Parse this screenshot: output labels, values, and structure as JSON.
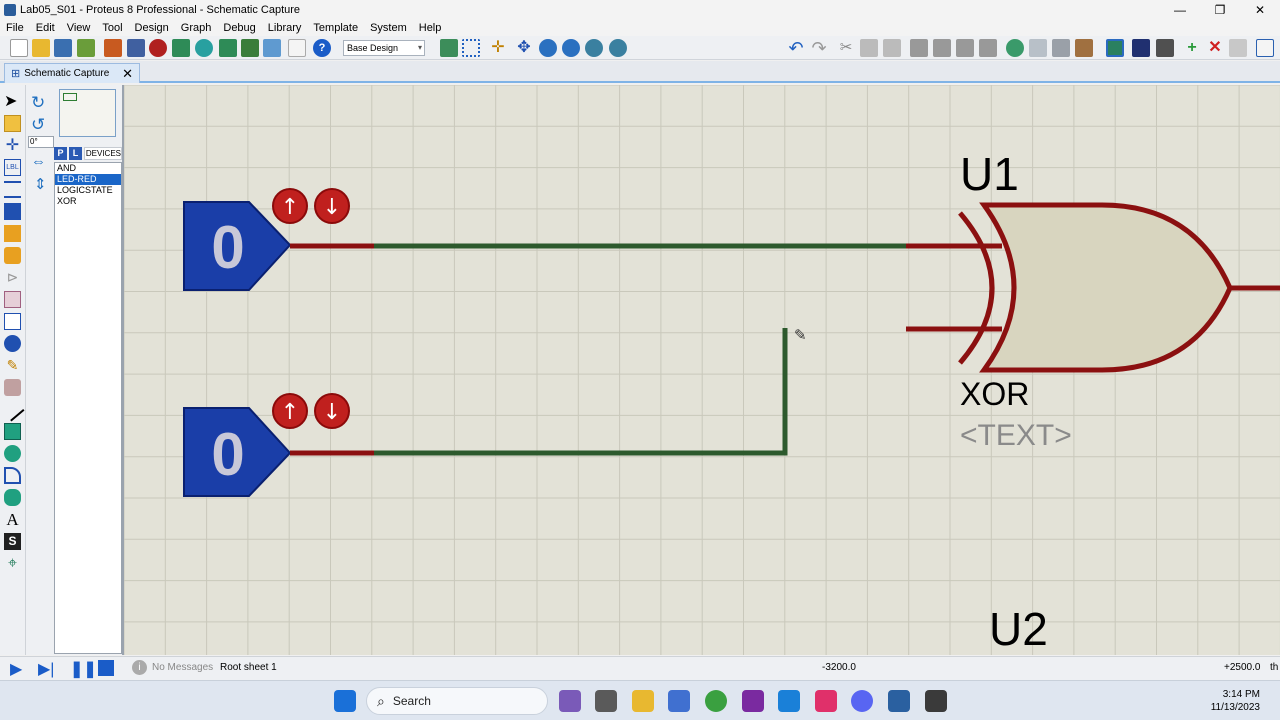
{
  "window": {
    "title": "Lab05_S01 - Proteus 8 Professional - Schematic Capture",
    "controls": {
      "minimize": "—",
      "maximize": "❐",
      "close": "✕"
    }
  },
  "menu": [
    "File",
    "Edit",
    "View",
    "Tool",
    "Design",
    "Graph",
    "Debug",
    "Library",
    "Template",
    "System",
    "Help"
  ],
  "toolbar": {
    "design_select": "Base Design",
    "icons": [
      "new-icon",
      "open-icon",
      "save-icon",
      "import-icon",
      "home-icon",
      "component-icon",
      "chip-icon",
      "back-icon",
      "zoom-area-icon",
      "layers-icon",
      "money-icon",
      "netlist-icon",
      "document-icon",
      "help-icon",
      "refresh-icon",
      "grid-icon",
      "origin-icon",
      "pan-icon",
      "zoom-in-icon",
      "zoom-out-icon",
      "zoom-all-icon",
      "zoom-fit-icon",
      "undo-icon",
      "redo-icon",
      "cut-icon",
      "copy-icon",
      "paste-icon",
      "block-copy-icon",
      "block-move-icon",
      "block-rotate-icon",
      "block-delete-icon",
      "pick-device-icon",
      "make-device-icon",
      "packaging-icon",
      "decompose-icon",
      "wire-autorouter-icon",
      "search-icon",
      "property-assign-icon",
      "new-sheet-icon",
      "remove-sheet-icon",
      "exit-sheet-icon",
      "bom-icon"
    ]
  },
  "tab": {
    "label": "Schematic Capture",
    "close": "✕"
  },
  "side": {
    "rotation": "0°",
    "pick_p": "P",
    "pick_l": "L",
    "devices_label": "DEVICES",
    "devices": [
      "AND",
      "LED-RED",
      "LOGICSTATE",
      "XOR"
    ],
    "selected_device": "LED-RED"
  },
  "schematic": {
    "logicstate1_value": "0",
    "logicstate2_value": "0",
    "gate_ref": "U1",
    "gate_type": "XOR",
    "gate_text": "<TEXT>",
    "next_ref": "U2"
  },
  "status": {
    "messages": "No Messages",
    "sheet": "Root sheet 1",
    "coord_x": "-3200.0",
    "coord_y": "+2500.0",
    "trailing": "th"
  },
  "taskbar": {
    "search_placeholder": "Search",
    "time": "3:14 PM",
    "date": "11/13/2023"
  },
  "colors": {
    "canvas": "#e3e2d7",
    "grid": "#c9c8bb",
    "wire": "#2d5a2d",
    "pin": "#8b1010",
    "gate_fill": "#d8d5bf",
    "logicstate": "#1a3ea8",
    "toggle": "#c0201e",
    "accent": "#1a66c8"
  }
}
